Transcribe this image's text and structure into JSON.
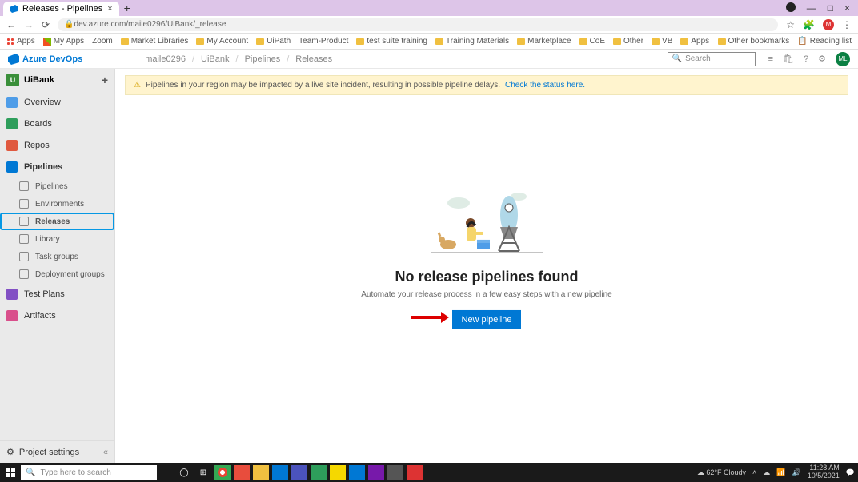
{
  "browser": {
    "tab_title": "Releases - Pipelines",
    "url": "dev.azure.com/maile0296/UiBank/_release",
    "bookmarks_left": [
      "Apps",
      "My Apps",
      "Zoom",
      "Market Libraries",
      "My Account",
      "UiPath",
      "Team-Product",
      "test suite training",
      "Training Materials",
      "Marketplace",
      "CoE",
      "Other",
      "VB",
      "Apps"
    ],
    "bookmarks_right": [
      "Other bookmarks",
      "Reading list"
    ]
  },
  "header": {
    "brand": "Azure DevOps",
    "breadcrumbs": [
      "maile0296",
      "UiBank",
      "Pipelines",
      "Releases"
    ],
    "search_placeholder": "Search",
    "avatar": "ML"
  },
  "sidebar": {
    "project_name": "UiBank",
    "project_initial": "U",
    "items": [
      {
        "label": "Overview",
        "icon": "#4f9de8"
      },
      {
        "label": "Boards",
        "icon": "#2e9e5b"
      },
      {
        "label": "Repos",
        "icon": "#e0593f"
      },
      {
        "label": "Pipelines",
        "icon": "#0078d4",
        "active": true
      },
      {
        "label": "Pipelines",
        "sub": true
      },
      {
        "label": "Environments",
        "sub": true
      },
      {
        "label": "Releases",
        "sub": true,
        "selected": true
      },
      {
        "label": "Library",
        "sub": true
      },
      {
        "label": "Task groups",
        "sub": true
      },
      {
        "label": "Deployment groups",
        "sub": true
      },
      {
        "label": "Test Plans",
        "icon": "#8250c4"
      },
      {
        "label": "Artifacts",
        "icon": "#d94f8b"
      }
    ],
    "footer": "Project settings"
  },
  "banner": {
    "text": "Pipelines in your region may be impacted by a live site incident, resulting in possible pipeline delays. ",
    "link": "Check the status here."
  },
  "empty_state": {
    "title": "No release pipelines found",
    "subtitle": "Automate your release process in a few easy steps with a new pipeline",
    "button": "New pipeline"
  },
  "taskbar": {
    "search_placeholder": "Type here to search",
    "weather": "62°F Cloudy",
    "time": "11:28 AM",
    "date": "10/5/2021"
  }
}
